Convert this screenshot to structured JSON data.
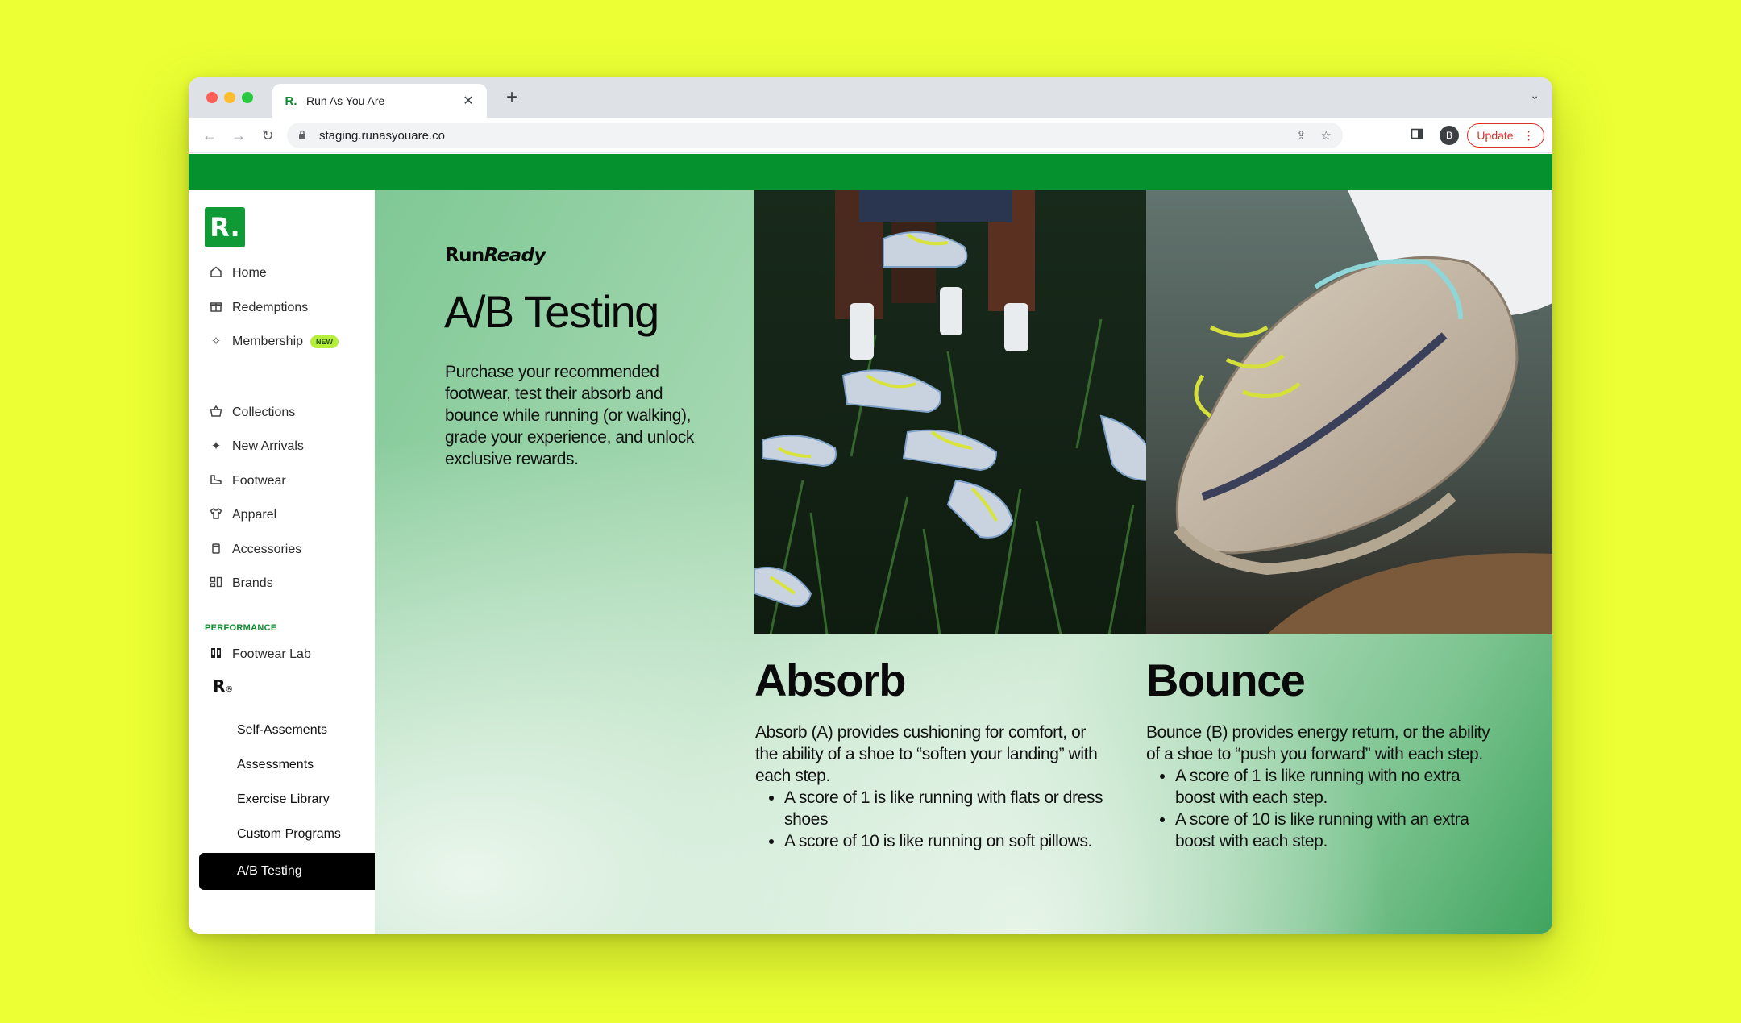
{
  "browser": {
    "tab_title": "Run As You Are",
    "tab_favicon": "R.",
    "url": "staging.runasyouare.co",
    "update_label": "Update",
    "avatar_initial": "B"
  },
  "sidebar": {
    "logo": "R.",
    "primary": [
      {
        "label": "Home",
        "icon": "home-icon"
      },
      {
        "label": "Redemptions",
        "icon": "gift-icon"
      },
      {
        "label": "Membership",
        "icon": "sparkle-icon",
        "badge": "NEW"
      }
    ],
    "shop": [
      {
        "label": "Collections",
        "icon": "basket-icon"
      },
      {
        "label": "New Arrivals",
        "icon": "stars-icon"
      },
      {
        "label": "Footwear",
        "icon": "shoe-icon"
      },
      {
        "label": "Apparel",
        "icon": "shirt-icon"
      },
      {
        "label": "Accessories",
        "icon": "bottle-icon"
      },
      {
        "label": "Brands",
        "icon": "brands-icon"
      }
    ],
    "section_label": "PERFORMANCE",
    "footwear_lab": "Footwear Lab",
    "r_mark": "R",
    "r_mark_symbol": "®",
    "sub_items": [
      "Self-Assements",
      "Assessments",
      "Exercise Library",
      "Custom Programs"
    ],
    "active_item": "A/B Testing"
  },
  "main": {
    "brand_run": "Run",
    "brand_ready": "Ready",
    "title": "A/B Testing",
    "intro": "Purchase your recommended footwear, test their absorb and bounce while running (or walking), grade your experience, and unlock exclusive rewards.",
    "absorb": {
      "title": "Absorb",
      "text": "Absorb (A) provides cushioning for comfort, or the ability of a shoe to “soften your landing” with each step.",
      "bullets": [
        "A score of 1 is like running with flats or dress shoes",
        "A score of 10 is like running on soft pillows."
      ]
    },
    "bounce": {
      "title": "Bounce",
      "text": "Bounce (B) provides energy return, or the ability of a shoe to “push you forward” with each step.",
      "bullets": [
        "A score of 1 is like running with no extra boost with each step.",
        "A score of 10 is like running with an extra boost with each step."
      ]
    }
  },
  "colors": {
    "background": "#ebff34",
    "brand_green": "#06912f",
    "logo_green": "#0f9a36"
  }
}
